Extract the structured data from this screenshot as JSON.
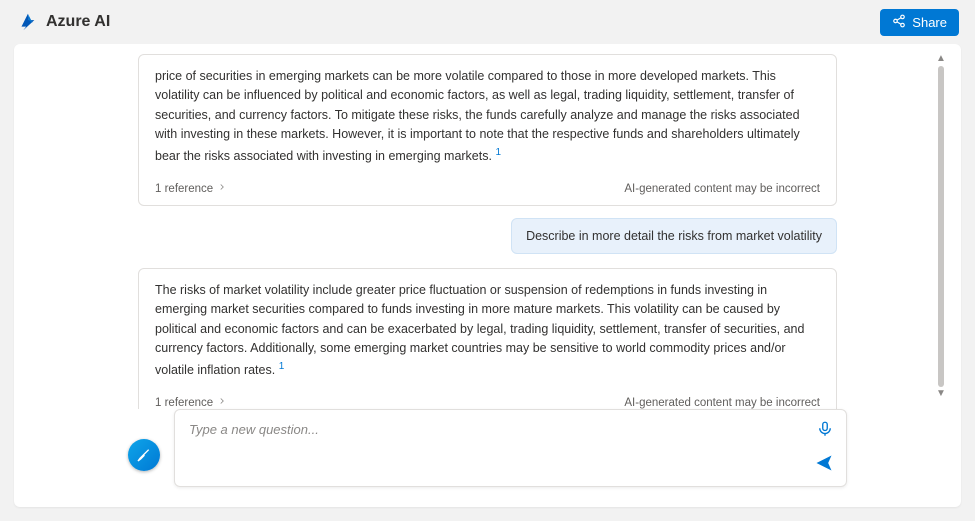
{
  "header": {
    "title": "Azure AI",
    "share_label": "Share"
  },
  "messages": {
    "ai1": {
      "text": "price of securities in emerging markets can be more volatile compared to those in more developed markets. This volatility can be influenced by political and economic factors, as well as legal, trading liquidity, settlement, transfer of securities, and currency factors. To mitigate these risks, the funds carefully analyze and manage the risks associated with investing in these markets. However, it is important to note that the respective funds and shareholders ultimately bear the risks associated with investing in emerging markets.",
      "citation": "1",
      "ref_label": "1 reference",
      "disclaimer": "AI-generated content may be incorrect"
    },
    "user1": {
      "text": "Describe in more detail the risks from market volatility"
    },
    "ai2": {
      "text": "The risks of market volatility include greater price fluctuation or suspension of redemptions in funds investing in emerging market securities compared to funds investing in more mature markets. This volatility can be caused by political and economic factors and can be exacerbated by legal, trading liquidity, settlement, transfer of securities, and currency factors. Additionally, some emerging market countries may be sensitive to world commodity prices and/or volatile inflation rates.",
      "citation": "1",
      "ref_label": "1 reference",
      "disclaimer": "AI-generated content may be incorrect"
    }
  },
  "input": {
    "placeholder": "Type a new question..."
  }
}
